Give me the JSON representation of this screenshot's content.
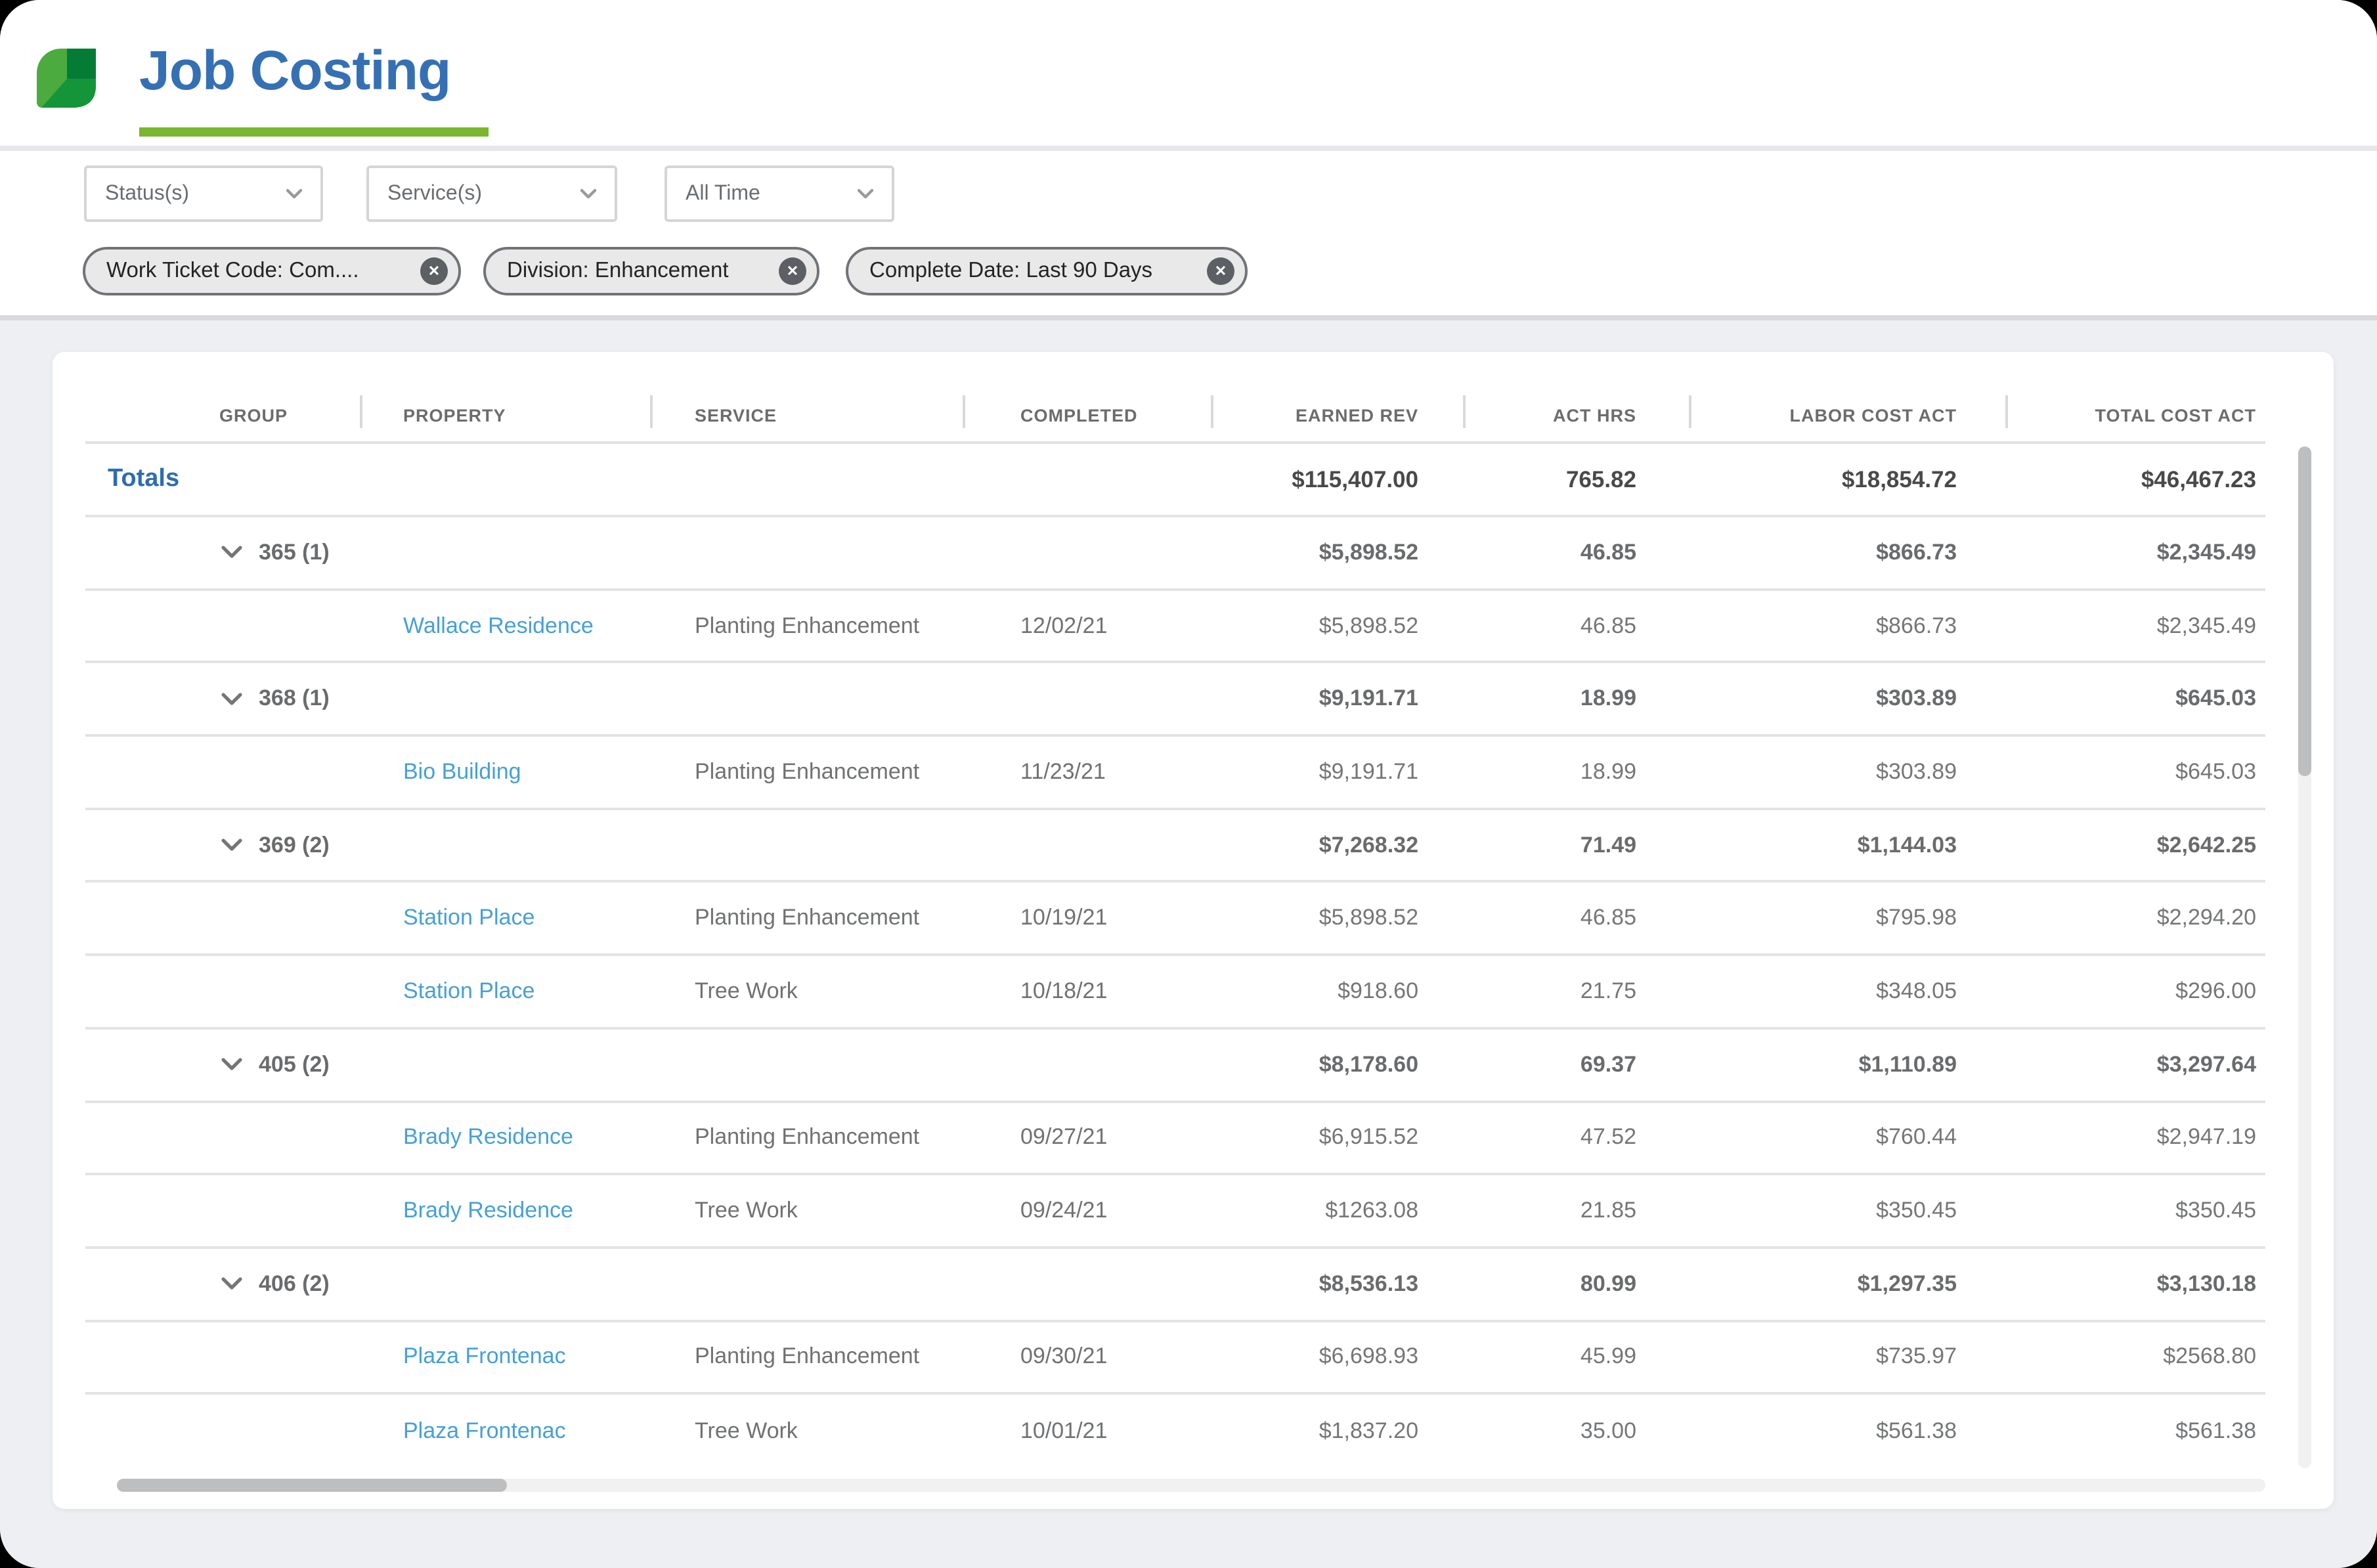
{
  "brand": {
    "title": "Job Costing"
  },
  "colors": {
    "title_blue": "#3570b4",
    "totals_blue": "#2e6cb2",
    "link_blue": "#47a0d5",
    "underline_green": "#7ab72e",
    "logo_green_light": "#4cab3e",
    "logo_green_mid": "#149539",
    "logo_green_dark": "#047c36",
    "background_gray": "#edeff3"
  },
  "filters": {
    "dropdowns": [
      {
        "label": "Status(s)"
      },
      {
        "label": "Service(s)"
      },
      {
        "label": "All Time"
      }
    ],
    "chips": [
      {
        "label": "Work Ticket Code: Com...."
      },
      {
        "label": "Division: Enhancement"
      },
      {
        "label": "Complete Date: Last 90 Days"
      }
    ]
  },
  "table": {
    "headers": [
      "GROUP",
      "PROPERTY",
      "SERVICE",
      "COMPLETED",
      "EARNED REV",
      "ACT HRS",
      "LABOR COST ACT",
      "TOTAL COST ACT"
    ],
    "totals": {
      "label": "Totals",
      "earned_rev": "$115,407.00",
      "act_hrs": "765.82",
      "labor_cost_act": "$18,854.72",
      "total_cost_act": "$46,467.23"
    },
    "rows": [
      {
        "type": "group",
        "group": "365",
        "count": "(1)",
        "earned_rev": "$5,898.52",
        "act_hrs": "46.85",
        "labor_cost_act": "$866.73",
        "total_cost_act": "$2,345.49"
      },
      {
        "type": "detail",
        "property": "Wallace Residence",
        "service": "Planting Enhancement",
        "completed": "12/02/21",
        "earned_rev": "$5,898.52",
        "act_hrs": "46.85",
        "labor_cost_act": "$866.73",
        "total_cost_act": "$2,345.49"
      },
      {
        "type": "group",
        "group": "368",
        "count": "(1)",
        "earned_rev": "$9,191.71",
        "act_hrs": "18.99",
        "labor_cost_act": "$303.89",
        "total_cost_act": "$645.03"
      },
      {
        "type": "detail",
        "property": "Bio Building",
        "service": "Planting Enhancement",
        "completed": "11/23/21",
        "earned_rev": "$9,191.71",
        "act_hrs": "18.99",
        "labor_cost_act": "$303.89",
        "total_cost_act": "$645.03"
      },
      {
        "type": "group",
        "group": "369",
        "count": "(2)",
        "earned_rev": "$7,268.32",
        "act_hrs": "71.49",
        "labor_cost_act": "$1,144.03",
        "total_cost_act": "$2,642.25"
      },
      {
        "type": "detail",
        "property": "Station Place",
        "service": "Planting Enhancement",
        "completed": "10/19/21",
        "earned_rev": "$5,898.52",
        "act_hrs": "46.85",
        "labor_cost_act": "$795.98",
        "total_cost_act": "$2,294.20"
      },
      {
        "type": "detail",
        "property": "Station Place",
        "service": "Tree Work",
        "completed": "10/18/21",
        "earned_rev": "$918.60",
        "act_hrs": "21.75",
        "labor_cost_act": "$348.05",
        "total_cost_act": "$296.00"
      },
      {
        "type": "group",
        "group": "405",
        "count": "(2)",
        "earned_rev": "$8,178.60",
        "act_hrs": "69.37",
        "labor_cost_act": "$1,110.89",
        "total_cost_act": "$3,297.64"
      },
      {
        "type": "detail",
        "property": "Brady Residence",
        "service": "Planting Enhancement",
        "completed": "09/27/21",
        "earned_rev": "$6,915.52",
        "act_hrs": "47.52",
        "labor_cost_act": "$760.44",
        "total_cost_act": "$2,947.19"
      },
      {
        "type": "detail",
        "property": "Brady Residence",
        "service": "Tree Work",
        "completed": "09/24/21",
        "earned_rev": "$1263.08",
        "act_hrs": "21.85",
        "labor_cost_act": "$350.45",
        "total_cost_act": "$350.45"
      },
      {
        "type": "group",
        "group": "406",
        "count": "(2)",
        "earned_rev": "$8,536.13",
        "act_hrs": "80.99",
        "labor_cost_act": "$1,297.35",
        "total_cost_act": "$3,130.18"
      },
      {
        "type": "detail",
        "property": "Plaza Frontenac",
        "service": "Planting Enhancement",
        "completed": "09/30/21",
        "earned_rev": "$6,698.93",
        "act_hrs": "45.99",
        "labor_cost_act": "$735.97",
        "total_cost_act": "$2568.80"
      },
      {
        "type": "detail",
        "property": "Plaza Frontenac",
        "service": "Tree Work",
        "completed": "10/01/21",
        "earned_rev": "$1,837.20",
        "act_hrs": "35.00",
        "labor_cost_act": "$561.38",
        "total_cost_act": "$561.38"
      }
    ]
  }
}
